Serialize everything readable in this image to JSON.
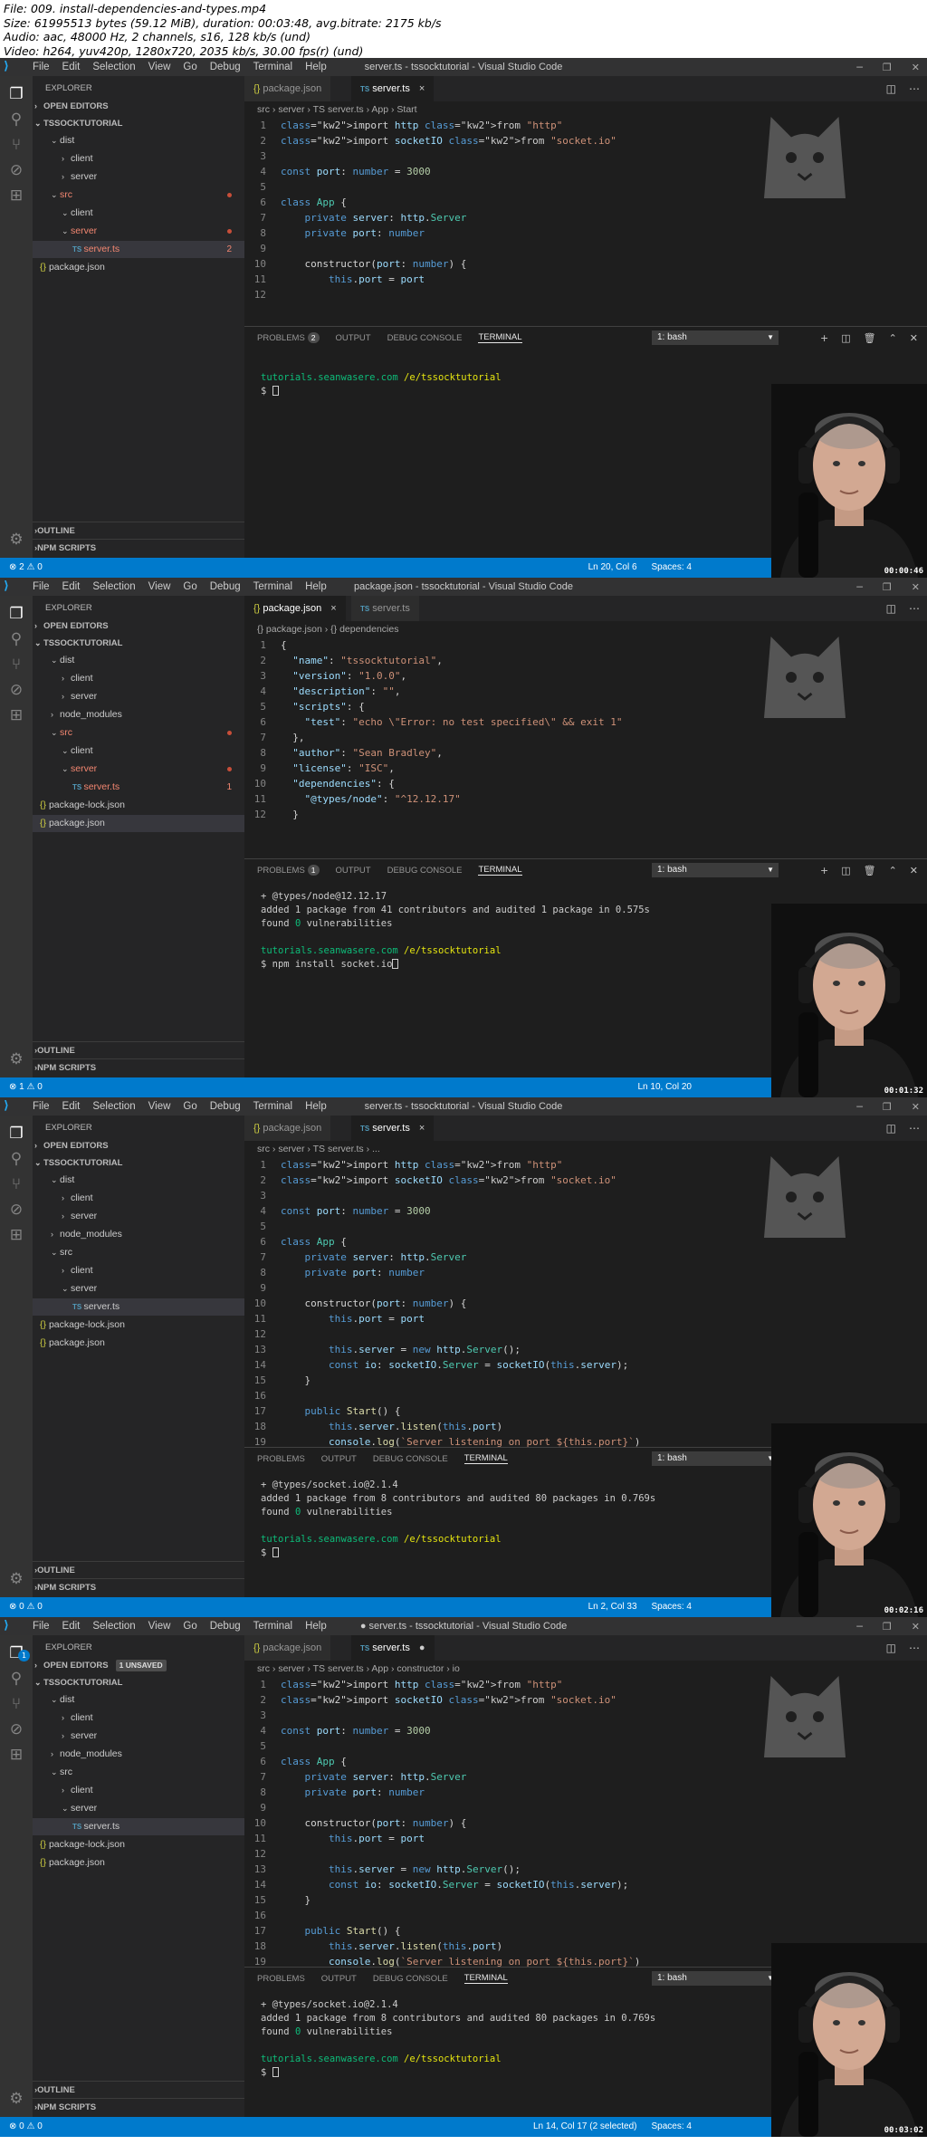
{
  "file_info": [
    "File: 009. install-dependencies-and-types.mp4",
    "Size: 61995513 bytes (59.12 MiB), duration: 00:03:48, avg.bitrate: 2175 kb/s",
    "Audio: aac, 48000 Hz, 2 channels, s16, 128 kb/s (und)",
    "Video: h264, yuv420p, 1280x720, 2035 kb/s, 30.00 fps(r) (und)"
  ],
  "menu": [
    "File",
    "Edit",
    "Selection",
    "View",
    "Go",
    "Debug",
    "Terminal",
    "Help"
  ],
  "frames": [
    {
      "window_title": "server.ts - tssocktutorial - Visual Studio Code",
      "timestamp": "00:00:46",
      "tabs": [
        {
          "label": "package.json",
          "icon": "{}",
          "active": false
        },
        {
          "label": "server.ts",
          "icon": "TS",
          "active": true,
          "close": "×"
        }
      ],
      "breadcrumb": "src › server › TS server.ts › App › Start",
      "sidebar_labels": {
        "explorer": "EXPLORER",
        "open_editors": "OPEN EDITORS",
        "project": "TSSOCKTUTORIAL",
        "outline": "OUTLINE",
        "npm": "NPM SCRIPTS"
      },
      "tree": [
        {
          "label": "dist",
          "depth": 1,
          "arrow": "v"
        },
        {
          "label": "client",
          "depth": 2,
          "arrow": ">"
        },
        {
          "label": "server",
          "depth": 2,
          "arrow": ">"
        },
        {
          "label": "src",
          "depth": 1,
          "arrow": "v",
          "red": true,
          "dot": true
        },
        {
          "label": "client",
          "depth": 2,
          "arrow": "v"
        },
        {
          "label": "server",
          "depth": 2,
          "arrow": "v",
          "red": true,
          "dot": true
        },
        {
          "label": "server.ts",
          "depth": 3,
          "type": "ts",
          "red": true,
          "count": "2",
          "selected": true
        },
        {
          "label": "package.json",
          "depth": 0,
          "type": "json"
        }
      ],
      "panel_problems": "2",
      "status_left": "⊗ 2 ⚠ 0",
      "status_right": [
        "Ln 20, Col 6",
        "Spaces: 4"
      ],
      "terminal": [
        {
          "text": "",
          "cls": ""
        },
        {
          "text": "tutorials.seanwasere.com /e/tssocktutorial",
          "cls": "path"
        },
        {
          "text": "$ ",
          "cls": "prompt"
        }
      ]
    },
    {
      "window_title": "package.json - tssocktutorial - Visual Studio Code",
      "timestamp": "00:01:32",
      "tabs": [
        {
          "label": "package.json",
          "icon": "{}",
          "active": true,
          "close": "×"
        },
        {
          "label": "server.ts",
          "icon": "TS",
          "active": false
        }
      ],
      "breadcrumb": "{} package.json › {} dependencies",
      "sidebar_labels": {
        "explorer": "EXPLORER",
        "open_editors": "OPEN EDITORS",
        "project": "TSSOCKTUTORIAL",
        "outline": "OUTLINE",
        "npm": "NPM SCRIPTS"
      },
      "tree": [
        {
          "label": "dist",
          "depth": 1,
          "arrow": "v"
        },
        {
          "label": "client",
          "depth": 2,
          "arrow": ">"
        },
        {
          "label": "server",
          "depth": 2,
          "arrow": ">"
        },
        {
          "label": "node_modules",
          "depth": 1,
          "arrow": ">"
        },
        {
          "label": "src",
          "depth": 1,
          "arrow": "v",
          "red": true,
          "dot": true
        },
        {
          "label": "client",
          "depth": 2,
          "arrow": "v"
        },
        {
          "label": "server",
          "depth": 2,
          "arrow": "v",
          "red": true,
          "dot": true
        },
        {
          "label": "server.ts",
          "depth": 3,
          "type": "ts",
          "red": true,
          "count": "1"
        },
        {
          "label": "package-lock.json",
          "depth": 0,
          "type": "json"
        },
        {
          "label": "package.json",
          "depth": 0,
          "type": "json",
          "selected": true
        }
      ],
      "panel_problems": "1",
      "status_left": "⊗ 1 ⚠ 0",
      "status_right": [
        "Ln 10, Col 20"
      ],
      "terminal": [
        {
          "text": "+ @types/node@12.12.17",
          "cls": ""
        },
        {
          "text": "added 1 package from 41 contributors and audited 1 package in 0.575s",
          "cls": ""
        },
        {
          "text": "found 0 vulnerabilities",
          "cls": ""
        },
        {
          "text": "",
          "cls": ""
        },
        {
          "text": "tutorials.seanwasere.com /e/tssocktutorial",
          "cls": "path"
        },
        {
          "text": "$ npm install socket.io",
          "cls": "prompt"
        }
      ]
    },
    {
      "window_title": "server.ts - tssocktutorial - Visual Studio Code",
      "timestamp": "00:02:16",
      "tabs": [
        {
          "label": "package.json",
          "icon": "{}",
          "active": false
        },
        {
          "label": "server.ts",
          "icon": "TS",
          "active": true,
          "close": "×"
        }
      ],
      "breadcrumb": "src › server › TS server.ts › ...",
      "sidebar_labels": {
        "explorer": "EXPLORER",
        "open_editors": "OPEN EDITORS",
        "project": "TSSOCKTUTORIAL",
        "outline": "OUTLINE",
        "npm": "NPM SCRIPTS"
      },
      "tree": [
        {
          "label": "dist",
          "depth": 1,
          "arrow": "v"
        },
        {
          "label": "client",
          "depth": 2,
          "arrow": ">"
        },
        {
          "label": "server",
          "depth": 2,
          "arrow": ">"
        },
        {
          "label": "node_modules",
          "depth": 1,
          "arrow": ">"
        },
        {
          "label": "src",
          "depth": 1,
          "arrow": "v"
        },
        {
          "label": "client",
          "depth": 2,
          "arrow": ">"
        },
        {
          "label": "server",
          "depth": 2,
          "arrow": "v"
        },
        {
          "label": "server.ts",
          "depth": 3,
          "type": "ts",
          "selected": true
        },
        {
          "label": "package-lock.json",
          "depth": 0,
          "type": "json"
        },
        {
          "label": "package.json",
          "depth": 0,
          "type": "json"
        }
      ],
      "panel_problems": "",
      "status_left": "⊗ 0 ⚠ 0",
      "status_right": [
        "Ln 2, Col 33",
        "Spaces: 4"
      ],
      "terminal": [
        {
          "text": "+ @types/socket.io@2.1.4",
          "cls": ""
        },
        {
          "text": "added 1 package from 8 contributors and audited 80 packages in 0.769s",
          "cls": ""
        },
        {
          "text": "found 0 vulnerabilities",
          "cls": ""
        },
        {
          "text": "",
          "cls": ""
        },
        {
          "text": "tutorials.seanwasere.com /e/tssocktutorial",
          "cls": "path"
        },
        {
          "text": "$ ",
          "cls": "prompt"
        }
      ]
    },
    {
      "window_title": "● server.ts - tssocktutorial - Visual Studio Code",
      "timestamp": "00:03:02",
      "tabs": [
        {
          "label": "package.json",
          "icon": "{}",
          "active": false
        },
        {
          "label": "server.ts",
          "icon": "TS",
          "active": true,
          "close": "●"
        }
      ],
      "breadcrumb": "src › server › TS server.ts › App › constructor › io",
      "sidebar_labels": {
        "explorer": "EXPLORER",
        "open_editors": "OPEN EDITORS",
        "unsaved": "1 UNSAVED",
        "project": "TSSOCKTUTORIAL",
        "outline": "OUTLINE",
        "npm": "NPM SCRIPTS"
      },
      "tree": [
        {
          "label": "dist",
          "depth": 1,
          "arrow": "v"
        },
        {
          "label": "client",
          "depth": 2,
          "arrow": ">"
        },
        {
          "label": "server",
          "depth": 2,
          "arrow": ">"
        },
        {
          "label": "node_modules",
          "depth": 1,
          "arrow": ">"
        },
        {
          "label": "src",
          "depth": 1,
          "arrow": "v"
        },
        {
          "label": "client",
          "depth": 2,
          "arrow": ">"
        },
        {
          "label": "server",
          "depth": 2,
          "arrow": "v"
        },
        {
          "label": "server.ts",
          "depth": 3,
          "type": "ts",
          "selected": true
        },
        {
          "label": "package-lock.json",
          "depth": 0,
          "type": "json"
        },
        {
          "label": "package.json",
          "depth": 0,
          "type": "json"
        }
      ],
      "panel_problems": "",
      "status_left": "⊗ 0 ⚠ 0",
      "status_right": [
        "Ln 14, Col 17 (2 selected)",
        "Spaces: 4"
      ],
      "terminal": [
        {
          "text": "+ @types/socket.io@2.1.4",
          "cls": ""
        },
        {
          "text": "added 1 package from 8 contributors and audited 80 packages in 0.769s",
          "cls": ""
        },
        {
          "text": "found 0 vulnerabilities",
          "cls": ""
        },
        {
          "text": "",
          "cls": ""
        },
        {
          "text": "tutorials.seanwasere.com /e/tssocktutorial",
          "cls": "path"
        },
        {
          "text": "$ ",
          "cls": "prompt"
        }
      ]
    }
  ],
  "panel_tabs": [
    "PROBLEMS",
    "OUTPUT",
    "DEBUG CONSOLE",
    "TERMINAL"
  ],
  "terminal_select": "1: bash",
  "code_server_ts": [
    "import http from \"http\"",
    "import socketIO from \"socket.io\"",
    "",
    "const port: number = 3000",
    "",
    "class App {",
    "    private server: http.Server",
    "    private port: number",
    "",
    "    constructor(port: number) {",
    "        this.port = port",
    "",
    "        this.server = new http.Server();",
    "        const io: socketIO.Server = socketIO(this.server);",
    "    }",
    "",
    "    public Start() {",
    "        this.server.listen(this.port)",
    "        console.log(`Server listening on port ${this.port}`)"
  ],
  "code_package_json": [
    "{",
    "  \"name\": \"tssocktutorial\",",
    "  \"version\": \"1.0.0\",",
    "  \"description\": \"\",",
    "  \"scripts\": {",
    "    \"test\": \"echo \\\"Error: no test specified\\\" && exit 1\"",
    "  },",
    "  \"author\": \"Sean Bradley\",",
    "  \"license\": \"ISC\",",
    "  \"dependencies\": {",
    "    \"@types/node\": \"^12.12.17\"",
    "  }"
  ]
}
